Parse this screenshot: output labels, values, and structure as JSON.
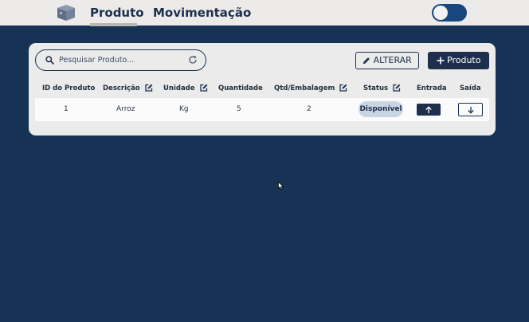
{
  "header": {
    "tabs": [
      {
        "label": "Produto",
        "active": true
      },
      {
        "label": "Movimentação",
        "active": false
      }
    ],
    "theme_toggle": {
      "state": "on"
    }
  },
  "toolbar": {
    "search_placeholder": "Pesquisar Produto...",
    "alter_label": "ALTERAR",
    "add_label": "Produto"
  },
  "table": {
    "columns": [
      "ID do Produto",
      "Descrição",
      "Unidade",
      "Quantidade",
      "Qtd/Embalagem",
      "Status",
      "Entrada",
      "Saída"
    ],
    "rows": [
      {
        "id": "1",
        "descricao": "Arroz",
        "unidade": "Kg",
        "quantidade": "5",
        "qtd_embalagem": "2",
        "status": "Disponível"
      }
    ]
  },
  "colors": {
    "background": "#163254",
    "primary": "#1d2f4d",
    "panel": "#ebebeb",
    "badge": "#c9d4e4",
    "toggle": "#18467d"
  }
}
